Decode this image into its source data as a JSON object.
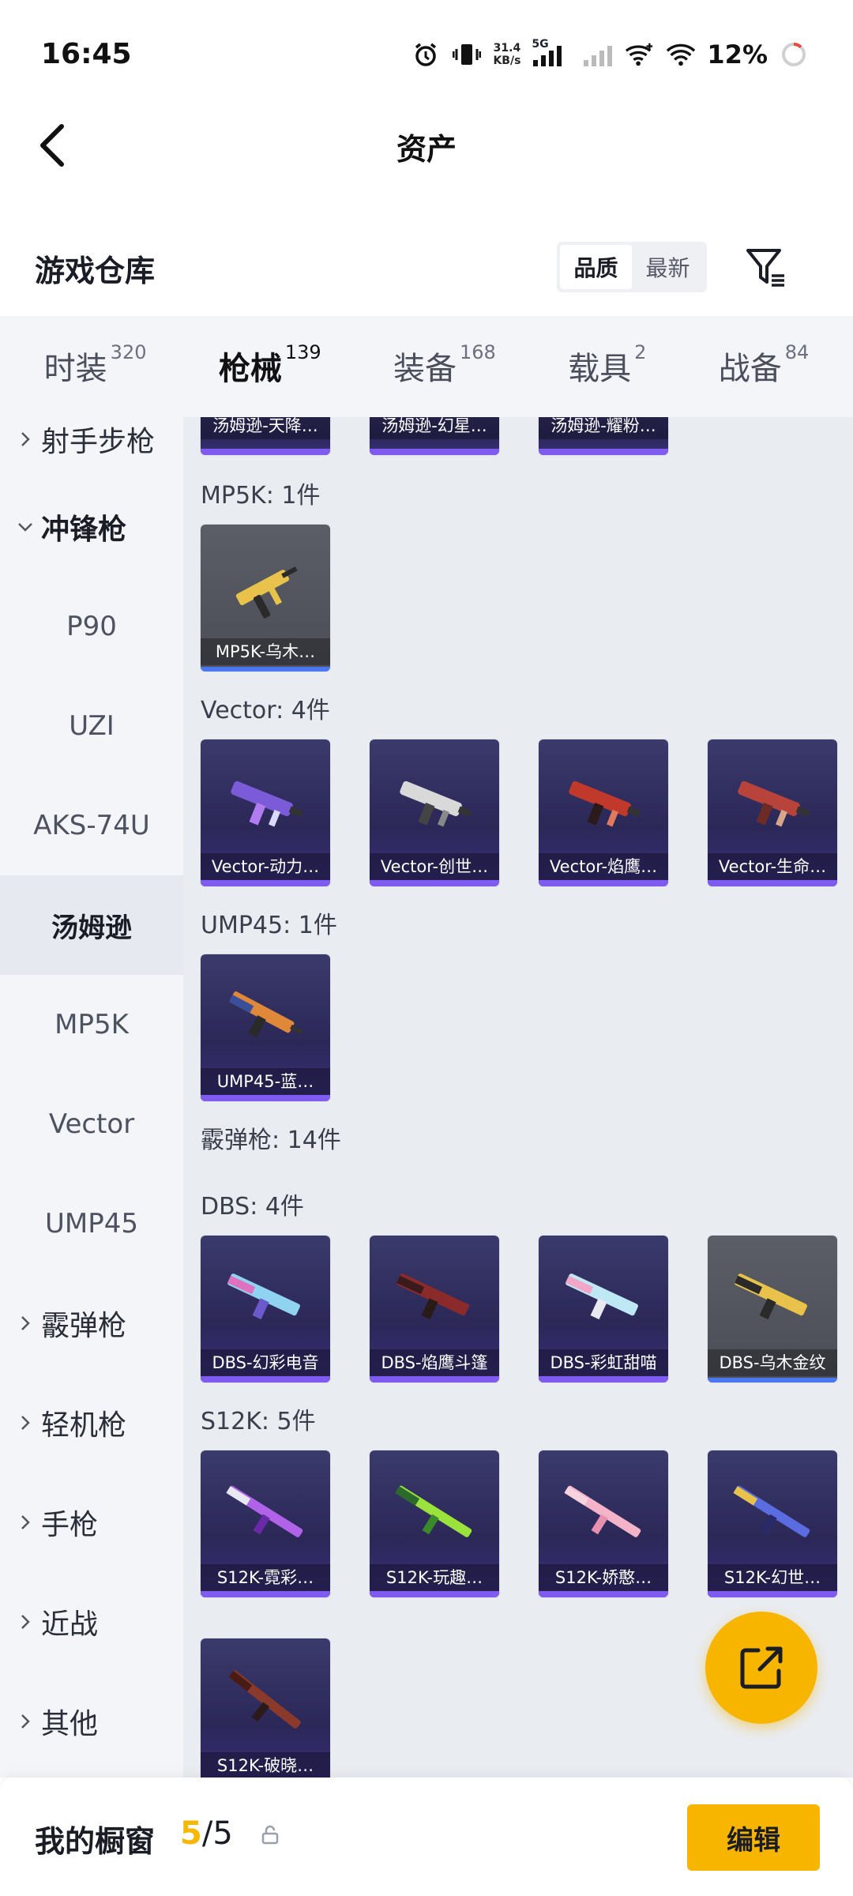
{
  "status_bar": {
    "time": "16:45",
    "net_speed_value": "31.4",
    "net_speed_unit": "KB/s",
    "network_type": "5G",
    "battery_percent": "12%",
    "icons": [
      "alarm-icon",
      "vibrate-icon",
      "signal-icon",
      "wifi-icon",
      "battery-icon"
    ]
  },
  "header": {
    "title": "资产",
    "back_icon": "chevron-left-icon"
  },
  "warehouse": {
    "title": "游戏仓库",
    "sort_options": [
      "品质",
      "最新"
    ],
    "sort_selected": "品质",
    "filter_icon": "filter-icon"
  },
  "tabs": [
    {
      "label": "时装",
      "count": "320",
      "active": false
    },
    {
      "label": "枪械",
      "count": "139",
      "active": true
    },
    {
      "label": "装备",
      "count": "168",
      "active": false
    },
    {
      "label": "载具",
      "count": "2",
      "active": false
    },
    {
      "label": "战备",
      "count": "84",
      "active": false
    }
  ],
  "sidebar": [
    {
      "label": "射手步枪",
      "type": "category",
      "expanded": false
    },
    {
      "label": "冲锋枪",
      "type": "category",
      "expanded": true
    },
    {
      "label": "P90",
      "type": "sub"
    },
    {
      "label": "UZI",
      "type": "sub"
    },
    {
      "label": "AKS-74U",
      "type": "sub"
    },
    {
      "label": "汤姆逊",
      "type": "sub",
      "selected": true
    },
    {
      "label": "MP5K",
      "type": "sub"
    },
    {
      "label": "Vector",
      "type": "sub"
    },
    {
      "label": "UMP45",
      "type": "sub"
    },
    {
      "label": "霰弹枪",
      "type": "category",
      "expanded": false
    },
    {
      "label": "轻机枪",
      "type": "category",
      "expanded": false
    },
    {
      "label": "手枪",
      "type": "category",
      "expanded": false
    },
    {
      "label": "近战",
      "type": "category",
      "expanded": false
    },
    {
      "label": "其他",
      "type": "category",
      "expanded": false
    }
  ],
  "content": {
    "top_partial_cards": [
      "汤姆逊-天降…",
      "汤姆逊-幻星…",
      "汤姆逊-耀粉…"
    ],
    "groups": [
      {
        "title": "MP5K: 1件",
        "items": [
          {
            "name": "MP5K-乌木…",
            "style": "gold",
            "accent": "#e8c24a"
          }
        ]
      },
      {
        "title": "Vector: 4件",
        "items": [
          {
            "name": "Vector-动力…",
            "style": "purple",
            "accent": "#b07cf0"
          },
          {
            "name": "Vector-创世…",
            "style": "purple",
            "accent": "#d9d9d9"
          },
          {
            "name": "Vector-焰鹰…",
            "style": "purple",
            "accent": "#c0392b"
          },
          {
            "name": "Vector-生命…",
            "style": "purple",
            "accent": "#b8433a"
          }
        ]
      },
      {
        "title": "UMP45: 1件",
        "items": [
          {
            "name": "UMP45-蓝…",
            "style": "purple",
            "accent": "#e0883a"
          }
        ]
      },
      {
        "title": "霰弹枪: 14件",
        "items": []
      },
      {
        "title": "DBS: 4件",
        "items": [
          {
            "name": "DBS-幻彩电音",
            "style": "purple",
            "accent": "#8fd3f0"
          },
          {
            "name": "DBS-焰鹰斗篷",
            "style": "purple",
            "accent": "#8a2a2a"
          },
          {
            "name": "DBS-彩虹甜喵",
            "style": "purple",
            "accent": "#bfe8f5"
          },
          {
            "name": "DBS-乌木金纹",
            "style": "gold",
            "accent": "#e8c24a"
          }
        ]
      },
      {
        "title": "S12K: 5件",
        "items": [
          {
            "name": "S12K-霓彩…",
            "style": "purple",
            "accent": "#b063e8"
          },
          {
            "name": "S12K-玩趣…",
            "style": "purple",
            "accent": "#9be23c"
          },
          {
            "name": "S12K-娇憨…",
            "style": "purple",
            "accent": "#f3b3c8"
          },
          {
            "name": "S12K-幻世…",
            "style": "purple",
            "accent": "#5a6ce0"
          },
          {
            "name": "S12K-破晓…",
            "style": "purple",
            "accent": "#8a3a2a"
          }
        ]
      }
    ]
  },
  "fab": {
    "icon": "share-external-icon",
    "color": "#f7b500"
  },
  "bottom_bar": {
    "label": "我的橱窗",
    "count_used": "5",
    "count_total": "/5",
    "lock_icon": "lock-icon",
    "edit_label": "编辑"
  }
}
